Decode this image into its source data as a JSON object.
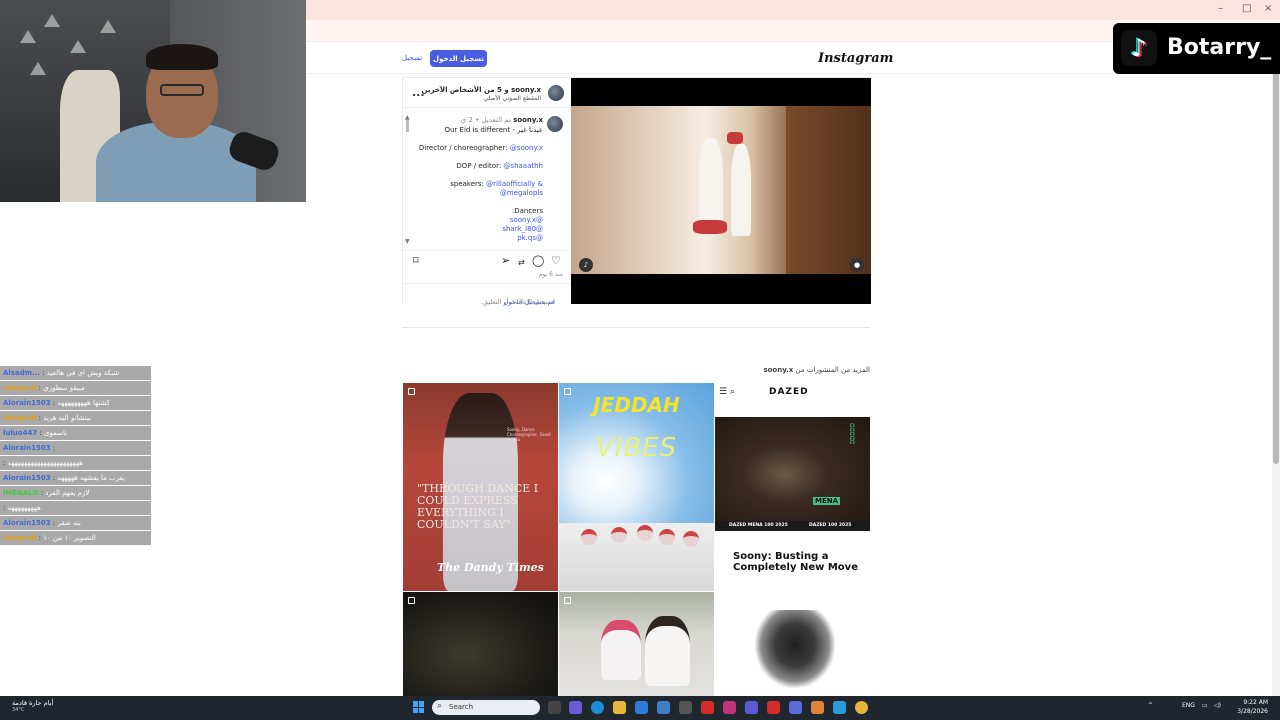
{
  "browser": {
    "minimize": "–",
    "restore": "□",
    "close": "×"
  },
  "instagram": {
    "logo": "Instagram",
    "login_button": "تسجيل الدخول",
    "signup_link": "تسجيل"
  },
  "post": {
    "header_title": "soony.x و 5 من الأشخاص الآخرين",
    "header_subtitle": "المقطع الصوتي الأصلي",
    "more_button": "...",
    "caption_username": "soony.x",
    "caption_meta": "تم التعديل • 2 ي",
    "caption_lines": [
      "Our Eid is different - عيدنا غير",
      "Director / choreographer: ",
      "DOP / editor: ",
      "speakers: ",
      "",
      ":Dancers",
      "",
      "",
      ""
    ],
    "caption_links": [
      "",
      "@soony.x",
      "@shaaathh",
      "@rillaofficially &",
      "@megalopls",
      "",
      "soony.x@",
      "shark_l80@",
      "pk.qs@"
    ],
    "date": "منذ 6 يوم",
    "login_note_prefix": "قم بتسجيل الدخول",
    "login_note_suffix": " لتسجيل الإعجاب أو التعليق."
  },
  "more_posts": {
    "label_prefix": "المزيد من المنشورات من ",
    "username": "soony.x"
  },
  "grid": {
    "tile1_quote": "\"THROUGH DANCE I COULD EXPRESS EVERYTHING I COULDN'T SAY\"",
    "tile1_masthead": "The Dandy Times",
    "tile1_small": "Soony, Dance Choreographer, Saudi Arabia",
    "tile2_title": "JEDDAH",
    "tile2_subtitle": "VIBES",
    "tile3_brand": "DAZED",
    "tile3_mena": "MENA",
    "tile3_tag1": "DAZED MENA 100 2025",
    "tile3_tag2": "DAZED 100 2025",
    "tile3_headline": "Soony: Busting a Completely New Move"
  },
  "overlay": {
    "badge_name": "Botarry_"
  },
  "chat": [
    {
      "name": "Alsadm...",
      "message": "شبكة ويش اي في هالعيد",
      "color": "#3d6bd9"
    },
    {
      "name": "abegosh",
      "message": "مبيقو سطوري",
      "color": "#e0a020"
    },
    {
      "name": "Alorain1503",
      "message": "كشتها هههههههههه",
      "color": "#3d6bd9"
    },
    {
      "name": "abegosh",
      "message": "بيتشانو اليه هريد",
      "color": "#e0a020"
    },
    {
      "name": "luluo447",
      "message": "ناسموى",
      "color": "#3d6bd9"
    },
    {
      "name": "Alorain1503",
      "message": "",
      "color": "#3d6bd9"
    },
    {
      "name": "",
      "message": "ههههههههههههههههههههههه",
      "color": "#3d6bd9"
    },
    {
      "name": "Alorain1503",
      "message": "يعرب ما يفشهه هههههه",
      "color": "#3d6bd9"
    },
    {
      "name": "iMEGALO",
      "message": "لازم يفهم القرد",
      "color": "#43c843"
    },
    {
      "name": "",
      "message": "هههههههههه",
      "color": "#3d6bd9"
    },
    {
      "name": "Alorain1503",
      "message": "بنه صقر",
      "color": "#3d6bd9"
    },
    {
      "name": "abegosh",
      "message": "التصوير ١٠ من ١٠",
      "color": "#e0a020"
    }
  ],
  "taskbar": {
    "weather_title": "أيام حارة قادمة",
    "weather_temp": "34°C",
    "search_label": "Search",
    "lang": "ENG",
    "time": "9:22 AM",
    "date": "3/28/2026"
  },
  "colors": {
    "accent": "#4a5de0",
    "link": "#3a55e0",
    "chrome": "#fbe4df"
  }
}
